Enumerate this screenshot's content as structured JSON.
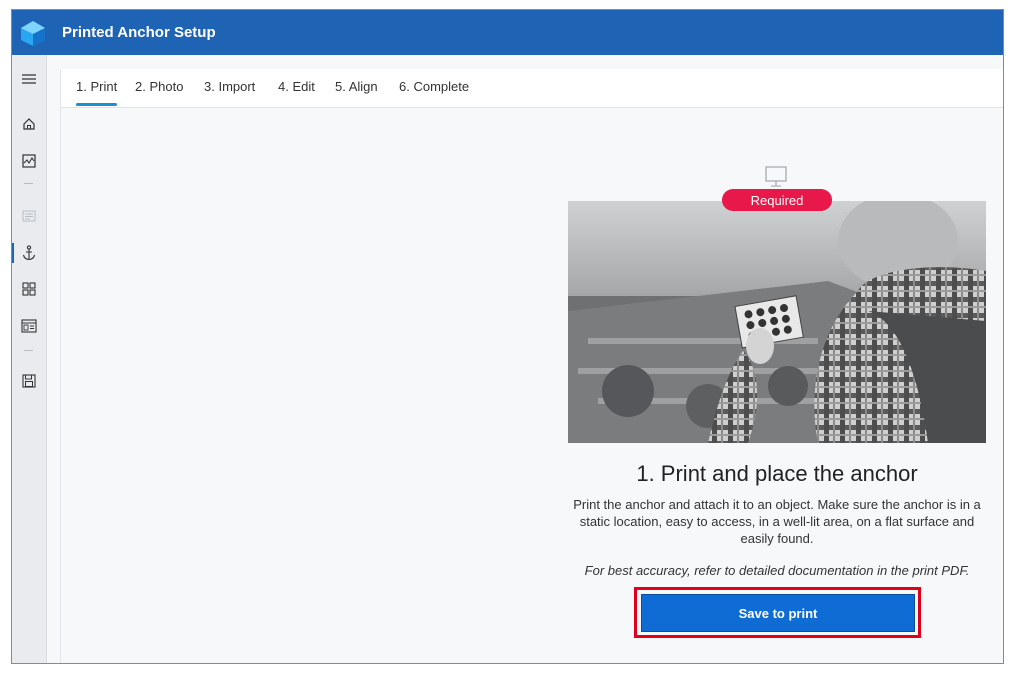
{
  "app": {
    "title": "Printed Anchor Setup"
  },
  "sidebar": {
    "items": [
      {
        "icon": "menu-icon"
      },
      {
        "icon": "home-icon"
      },
      {
        "icon": "activity-icon"
      },
      {
        "icon": "document-icon"
      },
      {
        "icon": "anchor-icon",
        "active": true
      },
      {
        "icon": "grid-icon"
      },
      {
        "icon": "layout-icon"
      },
      {
        "icon": "save-icon"
      }
    ]
  },
  "tabs": [
    {
      "label": "1. Print",
      "active": true
    },
    {
      "label": "2. Photo"
    },
    {
      "label": "3. Import"
    },
    {
      "label": "4. Edit"
    },
    {
      "label": "5. Align"
    },
    {
      "label": "6. Complete"
    }
  ],
  "main": {
    "badge": "Required",
    "heading": "1. Print and place the anchor",
    "description": "Print the anchor and attach it to an object. Make sure the anchor is in a static location, easy to access, in a well-lit area, on a flat surface and easily found.",
    "note": "For best accuracy, refer to detailed documentation in the print PDF.",
    "button_label": "Save to print"
  },
  "colors": {
    "titlebar": "#1f63b5",
    "accent": "#1a8fd6",
    "badge": "#e8194a",
    "button": "#0f6cd4",
    "highlight": "#e0001b"
  }
}
